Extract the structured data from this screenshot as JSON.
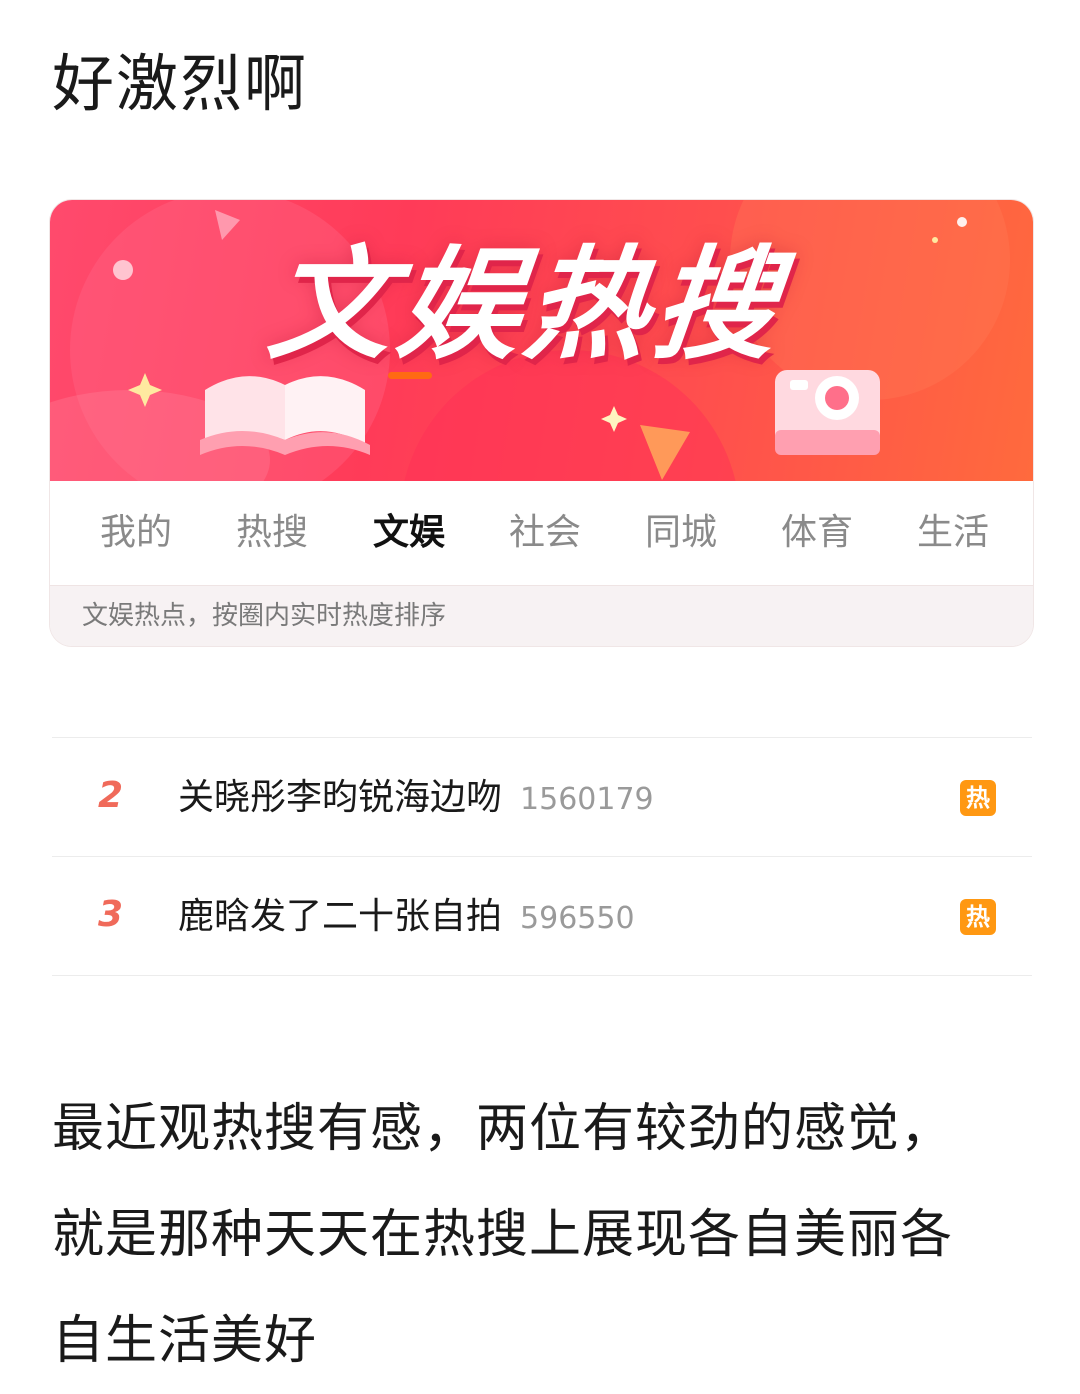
{
  "post": {
    "title": "好激烈啊",
    "body_line_1": "最近观热搜有感，两位有较劲的感觉，",
    "body_line_2": "就是那种天天在热搜上展现各自美丽各",
    "body_line_3": "自生活美好"
  },
  "hot_search": {
    "banner_title": "文娱热搜",
    "tabs": [
      {
        "label": "我的",
        "active": false
      },
      {
        "label": "热搜",
        "active": false
      },
      {
        "label": "文娱",
        "active": true
      },
      {
        "label": "社会",
        "active": false
      },
      {
        "label": "同城",
        "active": false
      },
      {
        "label": "体育",
        "active": false
      },
      {
        "label": "生活",
        "active": false
      }
    ],
    "subtitle": "文娱热点，按圈内实时热度排序",
    "items": [
      {
        "rank": "2",
        "text": "关晓彤李昀锐海边吻",
        "count": "1560179",
        "badge": "热"
      },
      {
        "rank": "3",
        "text": "鹿晗发了二十张自拍",
        "count": "596550",
        "badge": "热"
      }
    ]
  },
  "colors": {
    "accent": "#ff6a13",
    "banner_red": "#ff3b58",
    "rank_red": "#f06a5a",
    "badge_orange": "#ff9812"
  }
}
